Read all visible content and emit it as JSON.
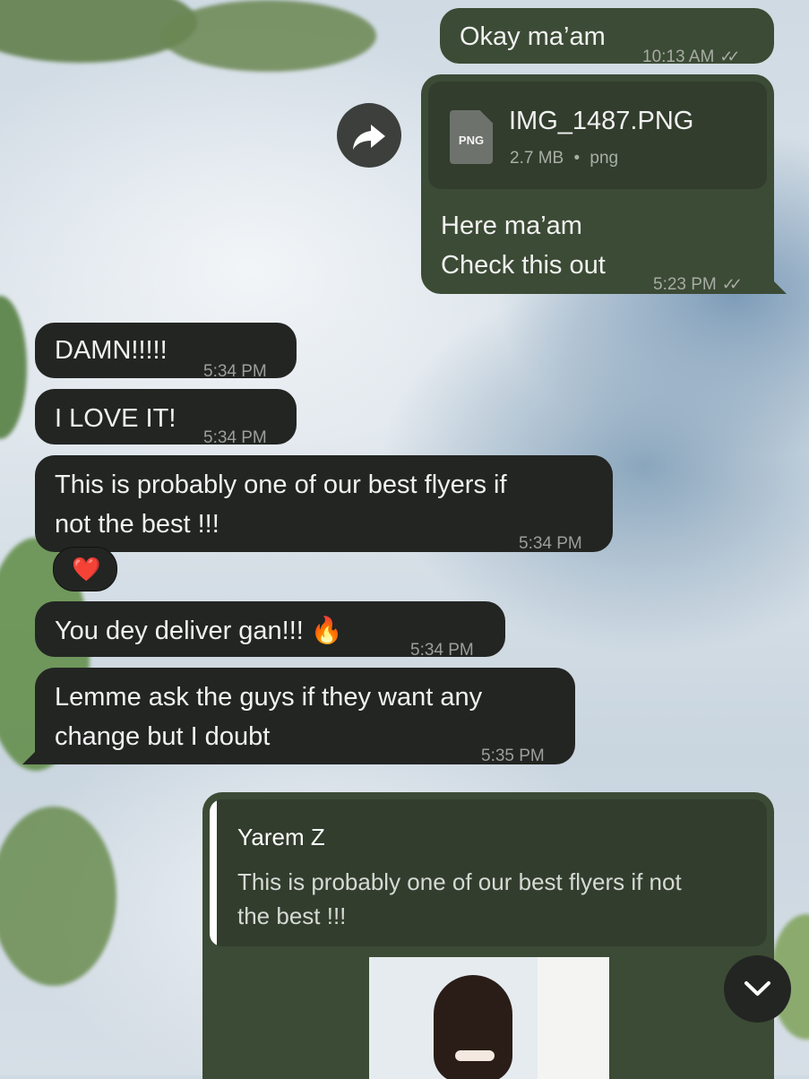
{
  "messages": {
    "m1": {
      "text": "Okay ma’am",
      "time": "10:13 AM"
    },
    "m2": {
      "file": {
        "name": "IMG_1487.PNG",
        "size": "2.7 MB",
        "sep": "•",
        "ext": "png",
        "badge": "PNG"
      },
      "line1": "Here ma’am",
      "line2": "Check this out",
      "time": "5:23 PM"
    },
    "m3": {
      "text": "DAMN!!!!!",
      "time": "5:34 PM"
    },
    "m4": {
      "text": "I LOVE IT!",
      "time": "5:34 PM"
    },
    "m5": {
      "line1": "This is probably one of our best flyers if",
      "line2": "not the best !!!",
      "time": "5:34 PM",
      "reaction": "❤️"
    },
    "m6": {
      "text": "You dey deliver gan!!!",
      "emoji": "🔥",
      "time": "5:34 PM"
    },
    "m7": {
      "line1": "Lemme ask the guys if they want any",
      "line2": "change but I doubt",
      "time": "5:35 PM"
    },
    "m8": {
      "reply_name": "Yarem Z",
      "reply_line1": "This is probably one of our best flyers if not",
      "reply_line2": "the best !!!"
    }
  },
  "icons": {
    "forward": "forward-arrow-icon",
    "scroll": "chevron-down-icon",
    "file": "file-icon"
  },
  "colors": {
    "outgoing": "#3c4b35",
    "incoming": "#232523",
    "reply_bar": "#ffffff"
  }
}
